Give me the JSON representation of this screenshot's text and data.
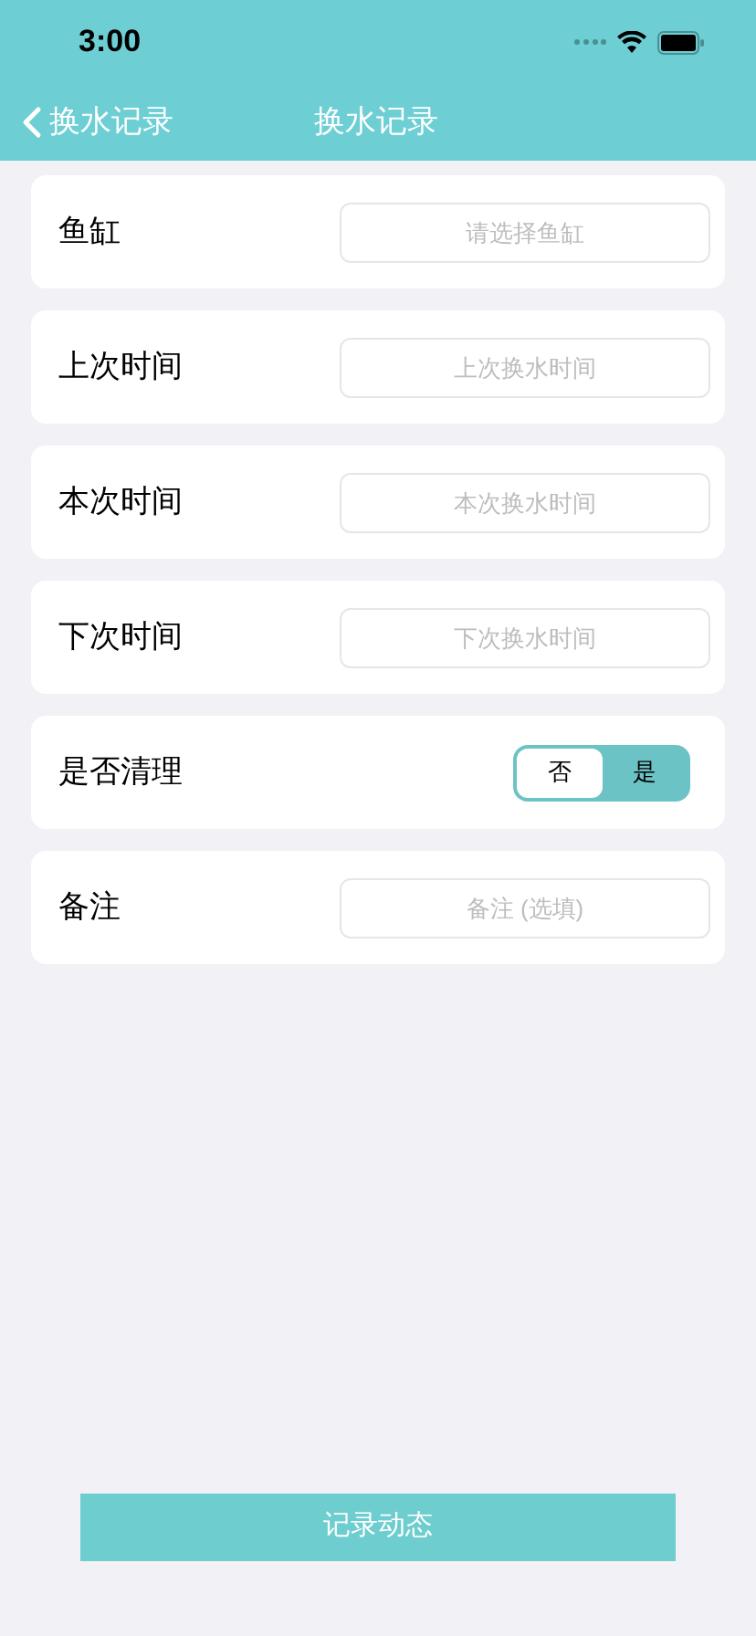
{
  "status_bar": {
    "time": "3:00"
  },
  "nav": {
    "back_label": "换水记录",
    "title": "换水记录"
  },
  "rows": [
    {
      "kind": "field",
      "label": "鱼缸",
      "placeholder": "请选择鱼缸"
    },
    {
      "kind": "field",
      "label": "上次时间",
      "placeholder": "上次换水时间"
    },
    {
      "kind": "field",
      "label": "本次时间",
      "placeholder": "本次换水时间"
    },
    {
      "kind": "field",
      "label": "下次时间",
      "placeholder": "下次换水时间"
    },
    {
      "kind": "toggle",
      "label": "是否清理",
      "options": [
        {
          "label": "否",
          "selected": true
        },
        {
          "label": "是",
          "selected": false
        }
      ]
    },
    {
      "kind": "field",
      "label": "备注",
      "placeholder": "备注 (选填)"
    }
  ],
  "submit_button": "记录动态"
}
